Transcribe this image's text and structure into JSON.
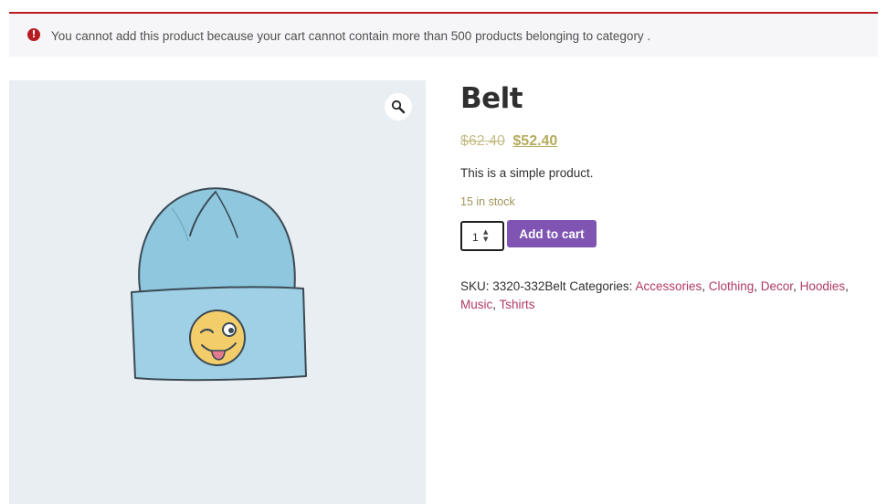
{
  "notice": {
    "icon": "error-icon",
    "color": "#b81c23",
    "text": "You cannot add this product because your cart cannot contain more than 500 products belonging to category ."
  },
  "gallery": {
    "zoom_icon": "magnifier-icon",
    "image": "blue-beanie-with-winking-emoji"
  },
  "product": {
    "title": "Belt",
    "price_regular": "$62.40",
    "price_sale": "$52.40",
    "description": "This is a simple product.",
    "stock": "15 in stock",
    "quantity": "1",
    "add_to_cart_label": "Add to cart",
    "accent_color": "#7f54b3"
  },
  "meta": {
    "sku_label": "SKU:",
    "sku_value": "3320-332Belt",
    "categories_label": "Categories:",
    "categories": [
      "Accessories",
      "Clothing",
      "Decor",
      "Hoodies",
      "Music",
      "Tshirts"
    ]
  }
}
